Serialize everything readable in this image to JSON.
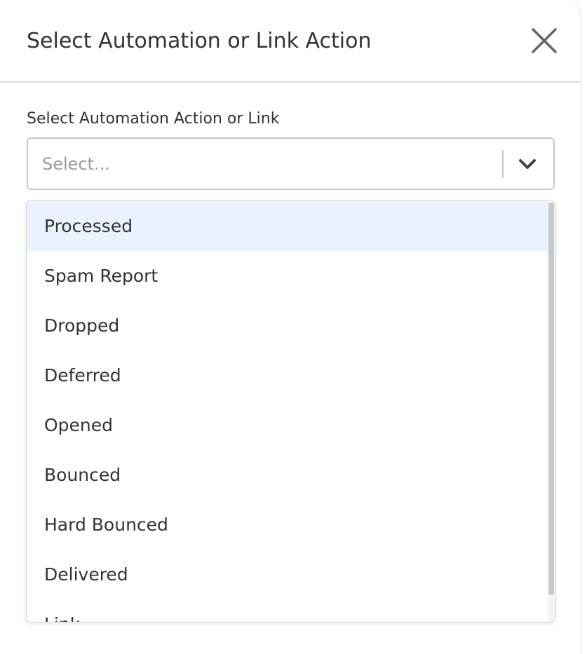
{
  "dialog": {
    "title": "Select Automation or Link Action",
    "close_icon": "close-icon"
  },
  "field": {
    "label": "Select Automation Action or Link",
    "placeholder": "Select...",
    "dropdown_icon": "chevron-down-icon"
  },
  "menu": {
    "options": [
      {
        "label": "Processed",
        "highlighted": true
      },
      {
        "label": "Spam Report",
        "highlighted": false
      },
      {
        "label": "Dropped",
        "highlighted": false
      },
      {
        "label": "Deferred",
        "highlighted": false
      },
      {
        "label": "Opened",
        "highlighted": false
      },
      {
        "label": "Bounced",
        "highlighted": false
      },
      {
        "label": "Hard Bounced",
        "highlighted": false
      },
      {
        "label": "Delivered",
        "highlighted": false
      },
      {
        "label": "Link",
        "highlighted": false
      }
    ]
  },
  "colors": {
    "highlight": "#eaf2fe",
    "text": "#333333",
    "placeholder": "#9a9a9a",
    "border": "#c8c8c8"
  }
}
